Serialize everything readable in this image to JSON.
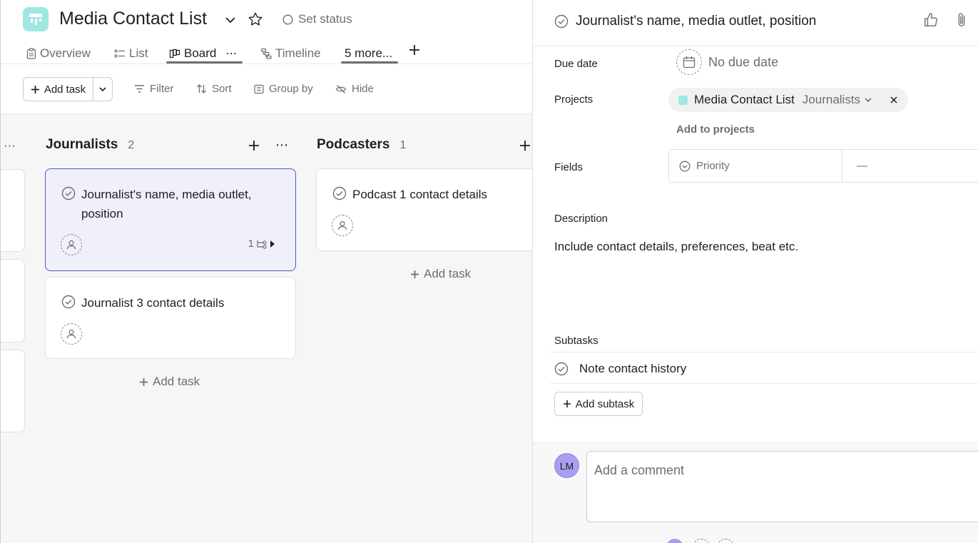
{
  "project": {
    "title": "Media Contact List",
    "set_status": "Set status",
    "icon": "board-icon",
    "color": "#9ee7e3"
  },
  "tabs": [
    {
      "label": "Overview",
      "icon": "clipboard-icon"
    },
    {
      "label": "List",
      "icon": "list-icon"
    },
    {
      "label": "Board",
      "icon": "board-icon",
      "active": true
    },
    {
      "label": "Timeline",
      "icon": "timeline-icon"
    },
    {
      "label": "5 more..."
    }
  ],
  "toolbar": {
    "add_task": "Add task",
    "filter": "Filter",
    "sort": "Sort",
    "group_by": "Group by",
    "hide": "Hide"
  },
  "board": {
    "columns": [
      {
        "name": "Journalists",
        "count": "2",
        "cards": [
          {
            "title": "Journalist's name, media outlet, position",
            "subtasks": "1",
            "selected": true
          },
          {
            "title": "Journalist 3 contact details"
          }
        ],
        "add_task": "Add task"
      },
      {
        "name": "Podcasters",
        "count": "1",
        "cards": [
          {
            "title": "Podcast 1 contact details"
          }
        ],
        "add_task": "Add task"
      }
    ]
  },
  "detail": {
    "title": "Journalist's name, media outlet, position",
    "due_date_label": "Due date",
    "due_date_value": "No due date",
    "projects_label": "Projects",
    "project_name": "Media Contact List",
    "project_section": "Journalists",
    "add_to_projects": "Add to projects",
    "fields_label": "Fields",
    "field_name": "Priority",
    "field_value": "—",
    "description_label": "Description",
    "description": "Include contact details, preferences, beat etc.",
    "subtasks_label": "Subtasks",
    "subtasks": [
      "Note contact history"
    ],
    "add_subtask": "Add subtask",
    "comment_placeholder": "Add a comment",
    "user_initials": "LM",
    "accent_color": "#4a5ac7",
    "avatar_color": "#a99ff1"
  }
}
